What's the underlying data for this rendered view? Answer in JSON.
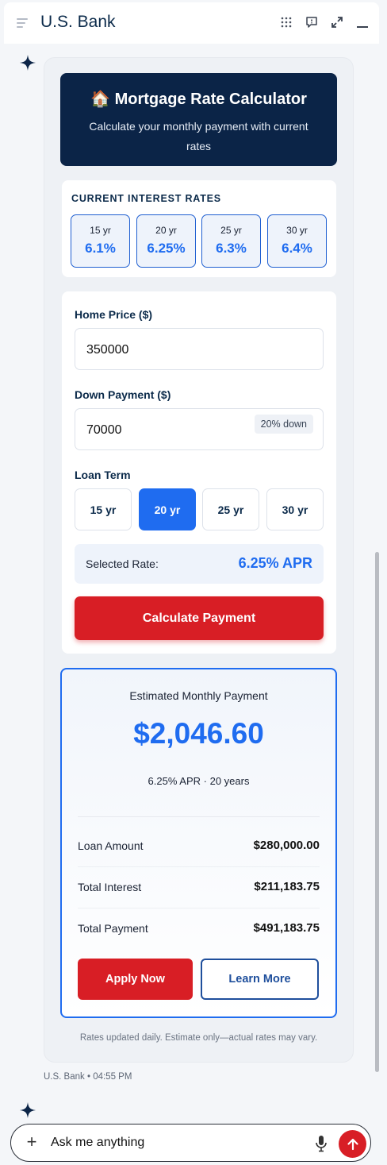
{
  "header": {
    "title": "U.S. Bank",
    "icons": [
      "menu-icon",
      "grid-icon",
      "feedback-icon",
      "expand-icon",
      "minimize-icon"
    ]
  },
  "calculator": {
    "hero": {
      "emoji": "🏠",
      "title": "Mortgage Rate Calculator",
      "subtitle": "Calculate your monthly payment with current rates"
    },
    "rates": {
      "label": "CURRENT INTEREST RATES",
      "items": [
        {
          "term": "15 yr",
          "rate": "6.1%"
        },
        {
          "term": "20 yr",
          "rate": "6.25%"
        },
        {
          "term": "25 yr",
          "rate": "6.3%"
        },
        {
          "term": "30 yr",
          "rate": "6.4%"
        }
      ]
    },
    "form": {
      "home_price_label": "Home Price ($)",
      "home_price_value": "350000",
      "down_payment_label": "Down Payment ($)",
      "down_payment_value": "70000",
      "down_badge": "20% down",
      "loan_term_label": "Loan Term",
      "terms": [
        "15 yr",
        "20 yr",
        "25 yr",
        "30 yr"
      ],
      "selected_term": "20 yr",
      "selected_rate_label": "Selected Rate:",
      "selected_rate_value": "6.25% APR",
      "calculate_label": "Calculate Payment"
    },
    "result": {
      "label": "Estimated Monthly Payment",
      "amount": "$2,046.60",
      "sub": "6.25% APR · 20 years",
      "rows": [
        {
          "label": "Loan Amount",
          "value": "$280,000.00"
        },
        {
          "label": "Total Interest",
          "value": "$211,183.75"
        },
        {
          "label": "Total Payment",
          "value": "$491,183.75"
        }
      ],
      "apply_label": "Apply Now",
      "learn_label": "Learn More"
    },
    "disclaimer": "Rates updated daily. Estimate only—actual rates may vary."
  },
  "message_meta": "U.S. Bank • 04:55 PM",
  "composer": {
    "placeholder": "Ask me anything"
  },
  "colors": {
    "brand_navy": "#0b2447",
    "accent_blue": "#1f6cf0",
    "accent_red": "#d81e25"
  }
}
